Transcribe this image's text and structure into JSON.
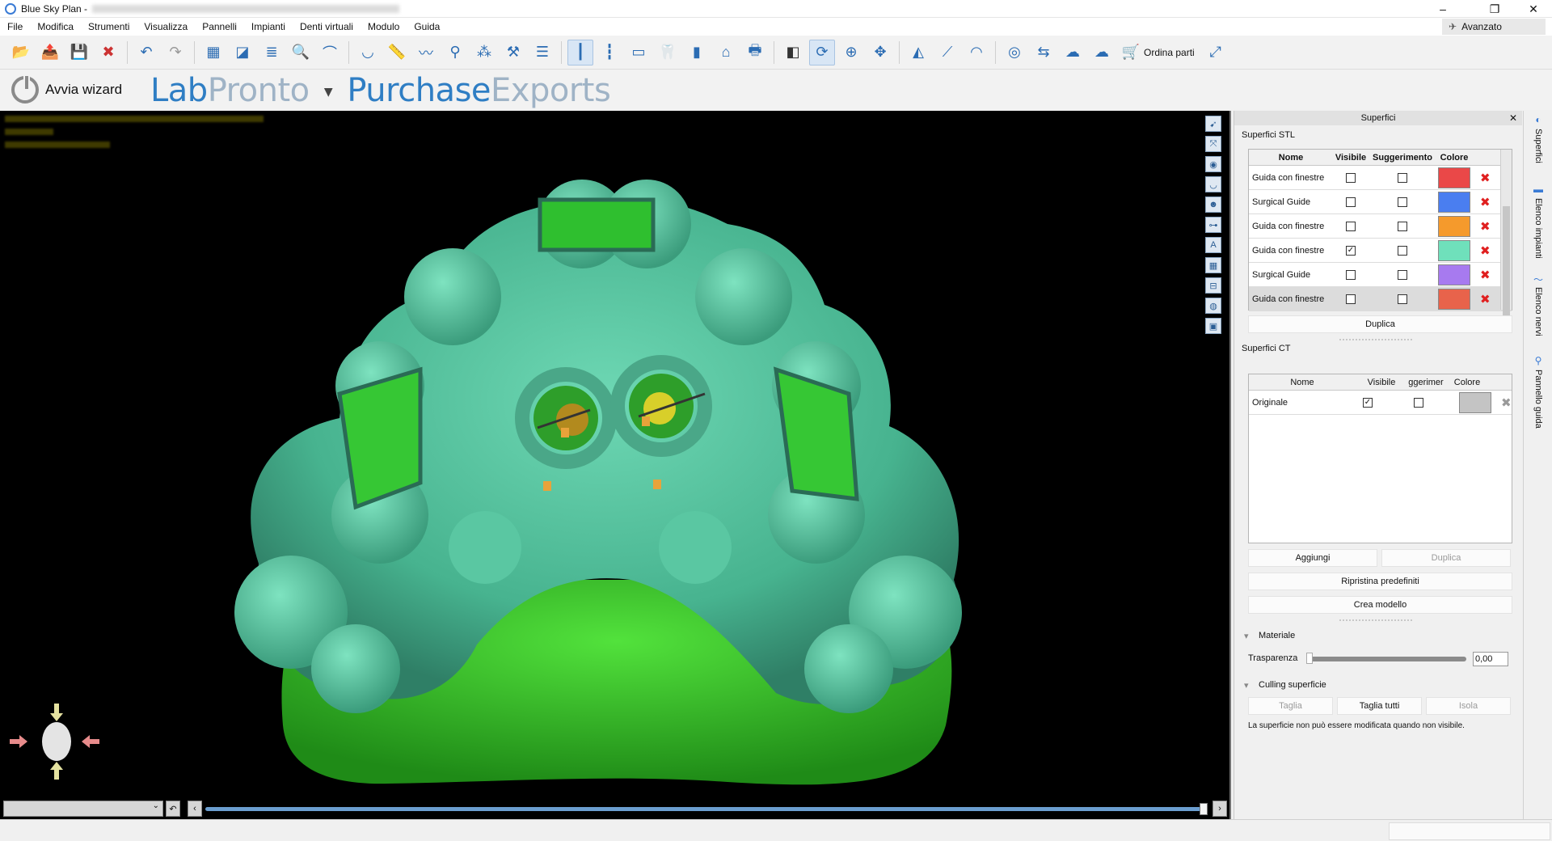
{
  "window": {
    "title": "Blue Sky Plan -"
  },
  "menu": [
    "File",
    "Modifica",
    "Strumenti",
    "Visualizza",
    "Pannelli",
    "Impianti",
    "Denti virtuali",
    "Modulo",
    "Guida"
  ],
  "mode": {
    "label": "Avanzato"
  },
  "toolbar": {
    "order_label": "Ordina parti"
  },
  "wizard": {
    "label": "Avvia wizard"
  },
  "brand": {
    "lab": "Lab",
    "pronto": "Pronto",
    "purchase": "Purchase",
    "exports": "Exports"
  },
  "side_panel": {
    "title": "Superfici",
    "stl": {
      "title": "Superfici STL",
      "headers": {
        "name": "Nome",
        "visible": "Visibile",
        "suggest": "Suggerimento",
        "color": "Colore"
      },
      "rows": [
        {
          "name": "Guida con finestre",
          "visible": false,
          "suggest": false,
          "color": "#ea4848"
        },
        {
          "name": "Surgical Guide",
          "visible": false,
          "suggest": false,
          "color": "#4a7ef0"
        },
        {
          "name": "Guida con finestre",
          "visible": false,
          "suggest": false,
          "color": "#f59a2c"
        },
        {
          "name": "Guida con finestre",
          "visible": true,
          "suggest": false,
          "color": "#6fe0bb"
        },
        {
          "name": "Surgical Guide",
          "visible": false,
          "suggest": false,
          "color": "#a77aef"
        },
        {
          "name": "Guida con finestre",
          "visible": false,
          "suggest": false,
          "color": "#e8634b"
        }
      ],
      "duplicate_label": "Duplica"
    },
    "ct": {
      "title": "Superfici CT",
      "headers": {
        "name": "Nome",
        "visible": "Visibile",
        "suggest": "ggerimer",
        "color": "Colore"
      },
      "rows": [
        {
          "name": "Originale",
          "visible": true,
          "suggest": false,
          "color": "#c4c4c4"
        }
      ],
      "add_label": "Aggiungi",
      "duplicate_label": "Duplica",
      "reset_label": "Ripristina predefiniti",
      "create_model_label": "Crea modello"
    },
    "material": {
      "title": "Materiale",
      "transparency_label": "Trasparenza",
      "transparency_value": "0,00"
    },
    "culling": {
      "title": "Culling superficie",
      "cut_label": "Taglia",
      "cut_all_label": "Taglia tutti",
      "isolate_label": "Isola",
      "note": "La superficie non può essere modificata quando non visibile."
    }
  },
  "vertical_tabs": [
    "Superfici",
    "Elenco impianti",
    "Elenco nervi",
    "Pannello guida"
  ]
}
